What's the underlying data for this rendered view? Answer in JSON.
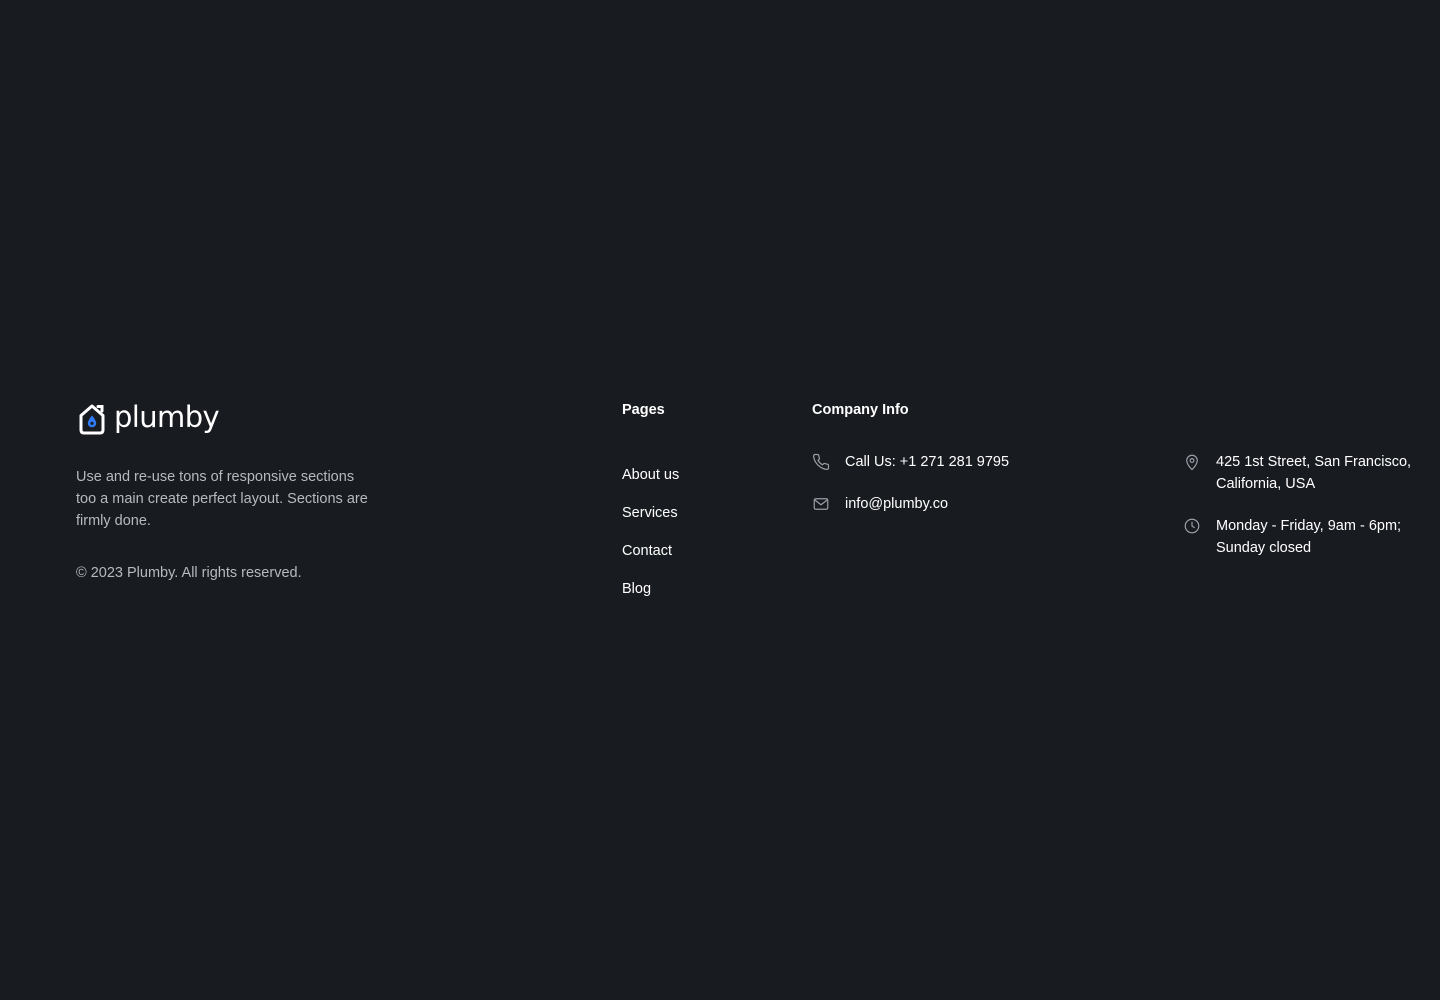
{
  "brand": {
    "name": "plumby",
    "description": "Use and re-use tons of responsive sections too a main create perfect layout. Sections are firmly done.",
    "copyright": "© 2023 Plumby. All rights reserved.",
    "accent_color": "#2f7bf5"
  },
  "pages": {
    "heading": "Pages",
    "items": [
      "About us",
      "Services",
      "Contact",
      "Blog"
    ]
  },
  "company": {
    "heading": "Company Info",
    "phone": {
      "icon": "phone-icon",
      "text": "Call Us: +1 271 281 9795"
    },
    "email": {
      "icon": "mail-icon",
      "text": "info@plumby.co"
    },
    "address": {
      "icon": "map-pin-icon",
      "line1": "425 1st Street, San Francisco,",
      "line2": "California, USA"
    },
    "hours": {
      "icon": "clock-icon",
      "line1": "Monday - Friday, 9am - 6pm;",
      "line2": "Sunday closed"
    }
  },
  "colors": {
    "background": "#181b20",
    "text_primary": "#ffffff",
    "text_muted": "#b6b9bf",
    "icon_muted": "#9a9ea6"
  }
}
